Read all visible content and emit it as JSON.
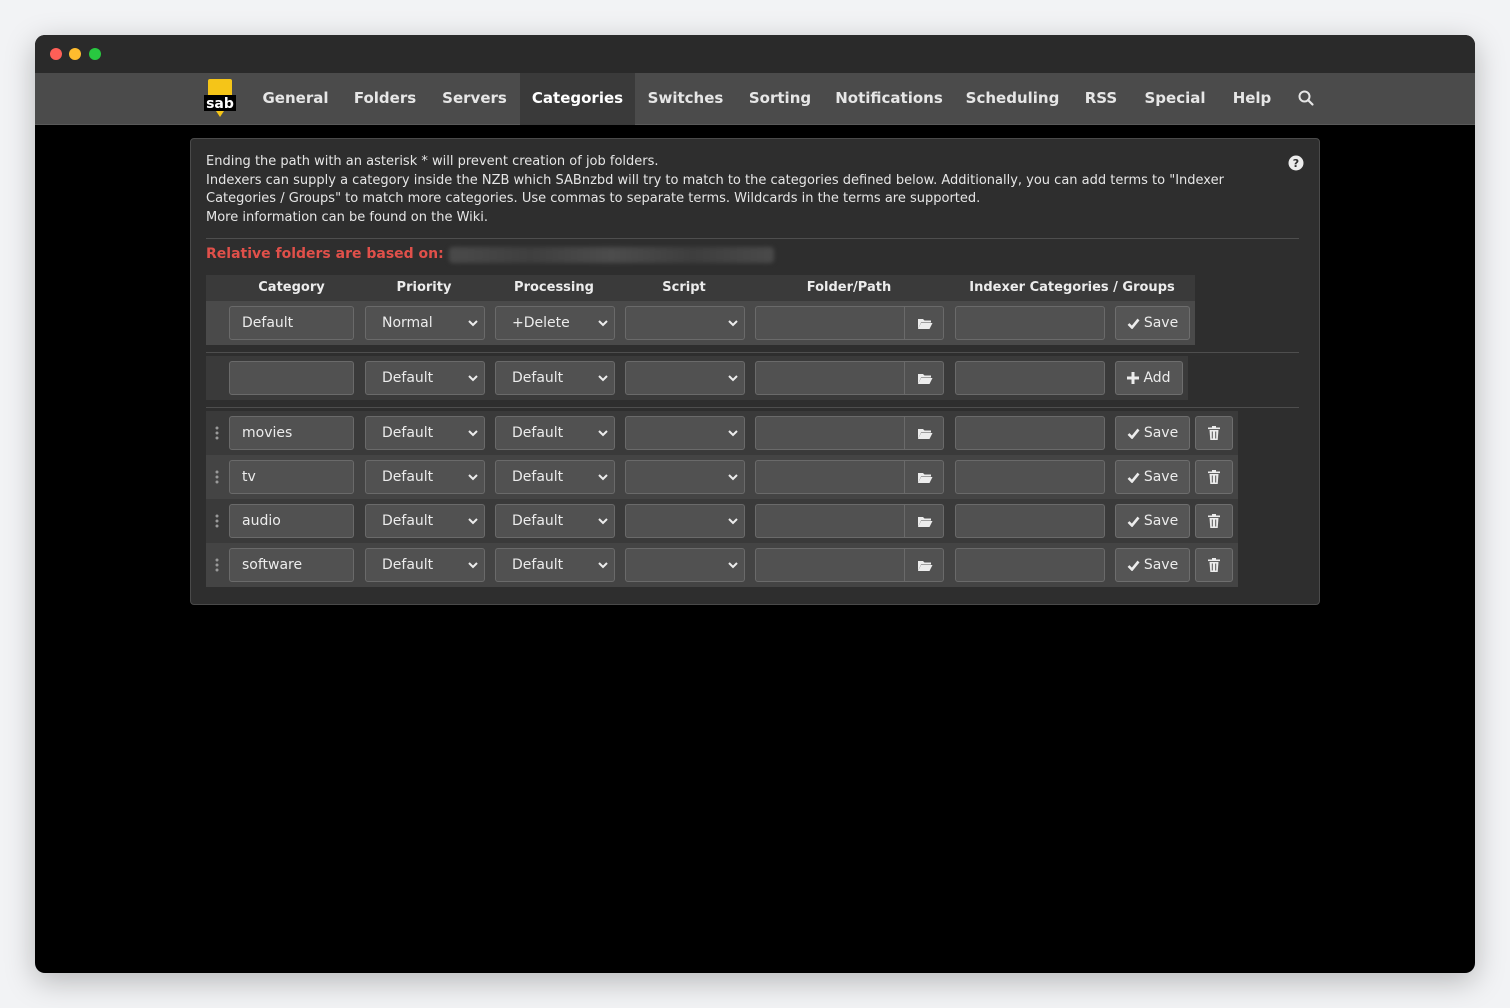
{
  "nav": {
    "items": [
      {
        "label": "General"
      },
      {
        "label": "Folders"
      },
      {
        "label": "Servers"
      },
      {
        "label": "Categories"
      },
      {
        "label": "Switches"
      },
      {
        "label": "Sorting"
      },
      {
        "label": "Notifications"
      },
      {
        "label": "Scheduling"
      },
      {
        "label": "RSS"
      },
      {
        "label": "Special"
      },
      {
        "label": "Help"
      }
    ],
    "active": "Categories",
    "logo_text": "sab"
  },
  "info": {
    "line1": "Ending the path with an asterisk * will prevent creation of job folders.",
    "line2": "Indexers can supply a category inside the NZB which SABnzbd will try to match to the categories defined below. Additionally, you can add terms to \"Indexer Categories / Groups\" to match more categories. Use commas to separate terms. Wildcards in the terms are supported.",
    "line3": "More information can be found on the Wiki."
  },
  "relative_label": "Relative folders are based on:",
  "columns": [
    "Category",
    "Priority",
    "Processing",
    "Script",
    "Folder/Path",
    "Indexer Categories / Groups"
  ],
  "default_row": {
    "category": "Default",
    "priority": "Normal",
    "processing": "+Delete",
    "script": "",
    "folder": "",
    "groups": "",
    "action": "Save"
  },
  "new_row": {
    "category": "",
    "priority": "Default",
    "processing": "Default",
    "script": "",
    "folder": "",
    "groups": "",
    "action": "Add"
  },
  "rows": [
    {
      "category": "movies",
      "priority": "Default",
      "processing": "Default",
      "script": "",
      "folder": "",
      "groups": "",
      "action": "Save"
    },
    {
      "category": "tv",
      "priority": "Default",
      "processing": "Default",
      "script": "",
      "folder": "",
      "groups": "",
      "action": "Save"
    },
    {
      "category": "audio",
      "priority": "Default",
      "processing": "Default",
      "script": "",
      "folder": "",
      "groups": "",
      "action": "Save"
    },
    {
      "category": "software",
      "priority": "Default",
      "processing": "Default",
      "script": "",
      "folder": "",
      "groups": "",
      "action": "Save"
    }
  ],
  "colors": {
    "accent_red": "#e0504a",
    "panel_bg": "#2e2e2e",
    "navbar_bg": "#4b4b4b",
    "logo_yellow": "#f5c518"
  }
}
